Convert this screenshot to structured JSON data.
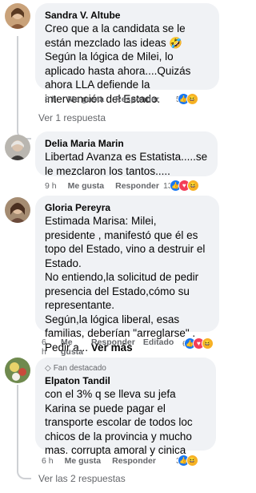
{
  "comments": [
    {
      "author": "Sandra V. Altube",
      "text": "Creo que a la candidata se le están mezclado las ideas 🤣 Según la lógica de Milei, lo aplicado hasta ahora....Quizás ahora LLA defiende la intervención del Estado.",
      "time": "8 h",
      "like": "Me gusta",
      "reply": "Responder",
      "reaction_count": "5",
      "replies_link": "Ver 1 respuesta"
    },
    {
      "author": "Delia Maria Marin",
      "text": "Libertad Avanza es Estatista.....se le mezclaron los tantos.....",
      "time": "9 h",
      "like": "Me gusta",
      "reply": "Responder",
      "reaction_count": "13"
    },
    {
      "author": "Gloria Pereyra",
      "text": "Estimada Marisa: Milei, presidente , manifestó que él es topo del Estado, vino a destruir el Estado.\nNo entiendo,la solicitud de pedir presencia del Estado,cómo su representante.\nSegún,la lógica liberal, esas familias, deberían \"arreglarse\" .\nPedir a...",
      "see_more": "Ver más",
      "time": "6 h",
      "like": "Me gusta",
      "reply": "Responder",
      "edited": "Editado",
      "reaction_count": "6"
    },
    {
      "badge": "Fan destacado",
      "author": "Elpaton Tandil",
      "text": "con el 3% q se lleva su jefa Karina se puede pagar el transporte escolar de todos loc chicos de la provincia y mucho mas. corrupta amoral y cinica",
      "time": "6 h",
      "like": "Me gusta",
      "reply": "Responder",
      "reaction_count": "3",
      "replies_link": "Ver las 2 respuestas"
    }
  ]
}
